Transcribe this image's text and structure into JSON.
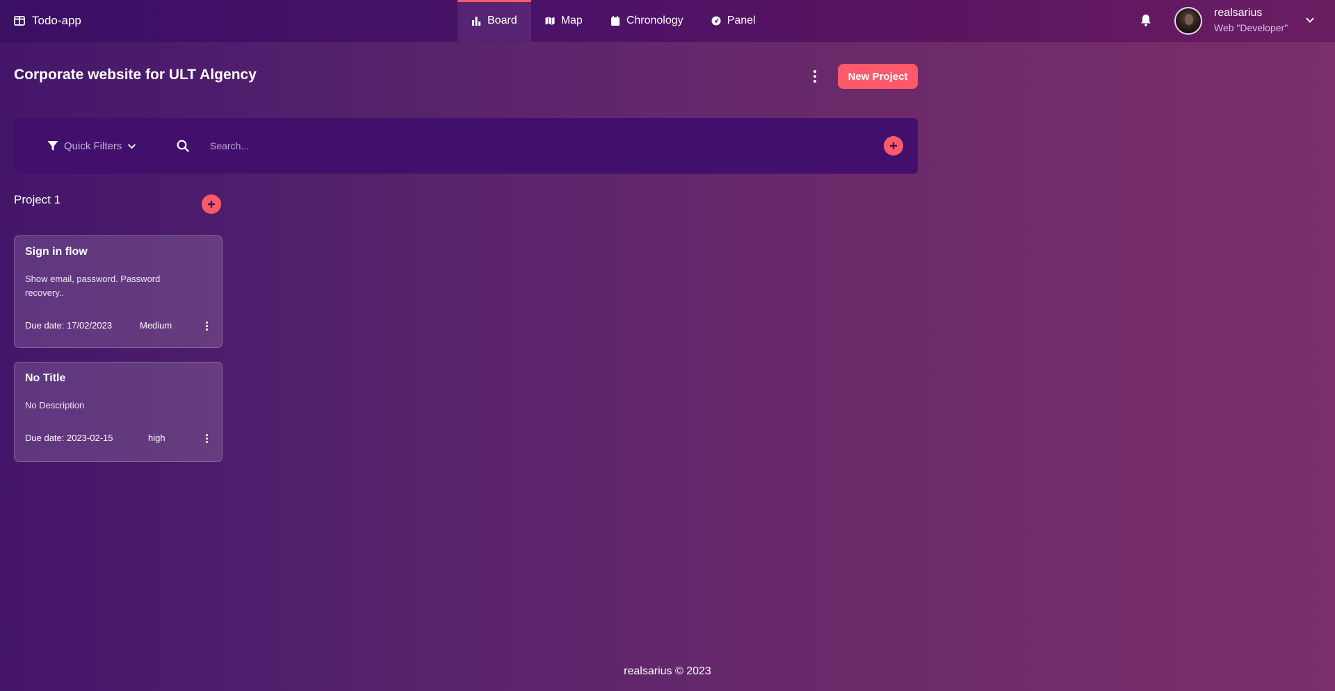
{
  "app": {
    "name": "Todo-app"
  },
  "nav": {
    "tabs": [
      {
        "label": "Board",
        "icon": "bar-chart-icon",
        "active": true
      },
      {
        "label": "Map",
        "icon": "map-icon",
        "active": false
      },
      {
        "label": "Chronology",
        "icon": "calendar-icon",
        "active": false
      },
      {
        "label": "Panel",
        "icon": "dashboard-icon",
        "active": false
      }
    ]
  },
  "user": {
    "name": "realsarius",
    "role": "Web \"Developer\""
  },
  "header": {
    "title": "Corporate website for ULT Algency",
    "new_project_label": "New Project"
  },
  "filters": {
    "quick_filters_label": "Quick Filters",
    "search_placeholder": "Search...",
    "search_value": ""
  },
  "project": {
    "title": "Project 1",
    "cards": [
      {
        "title": "Sign in flow",
        "description": "Show email, password. Password recovery..",
        "due": "Due date: 17/02/2023",
        "priority": "Medium"
      },
      {
        "title": "No Title",
        "description": "No Description",
        "due": "Due date: 2023-02-15",
        "priority": "high"
      }
    ]
  },
  "footer": {
    "text": "realsarius © 2023"
  },
  "colors": {
    "accent": "#fc5a6b",
    "filter_bar": "#420f6c",
    "navbar": "#4a1268",
    "background": "#5a246d"
  }
}
